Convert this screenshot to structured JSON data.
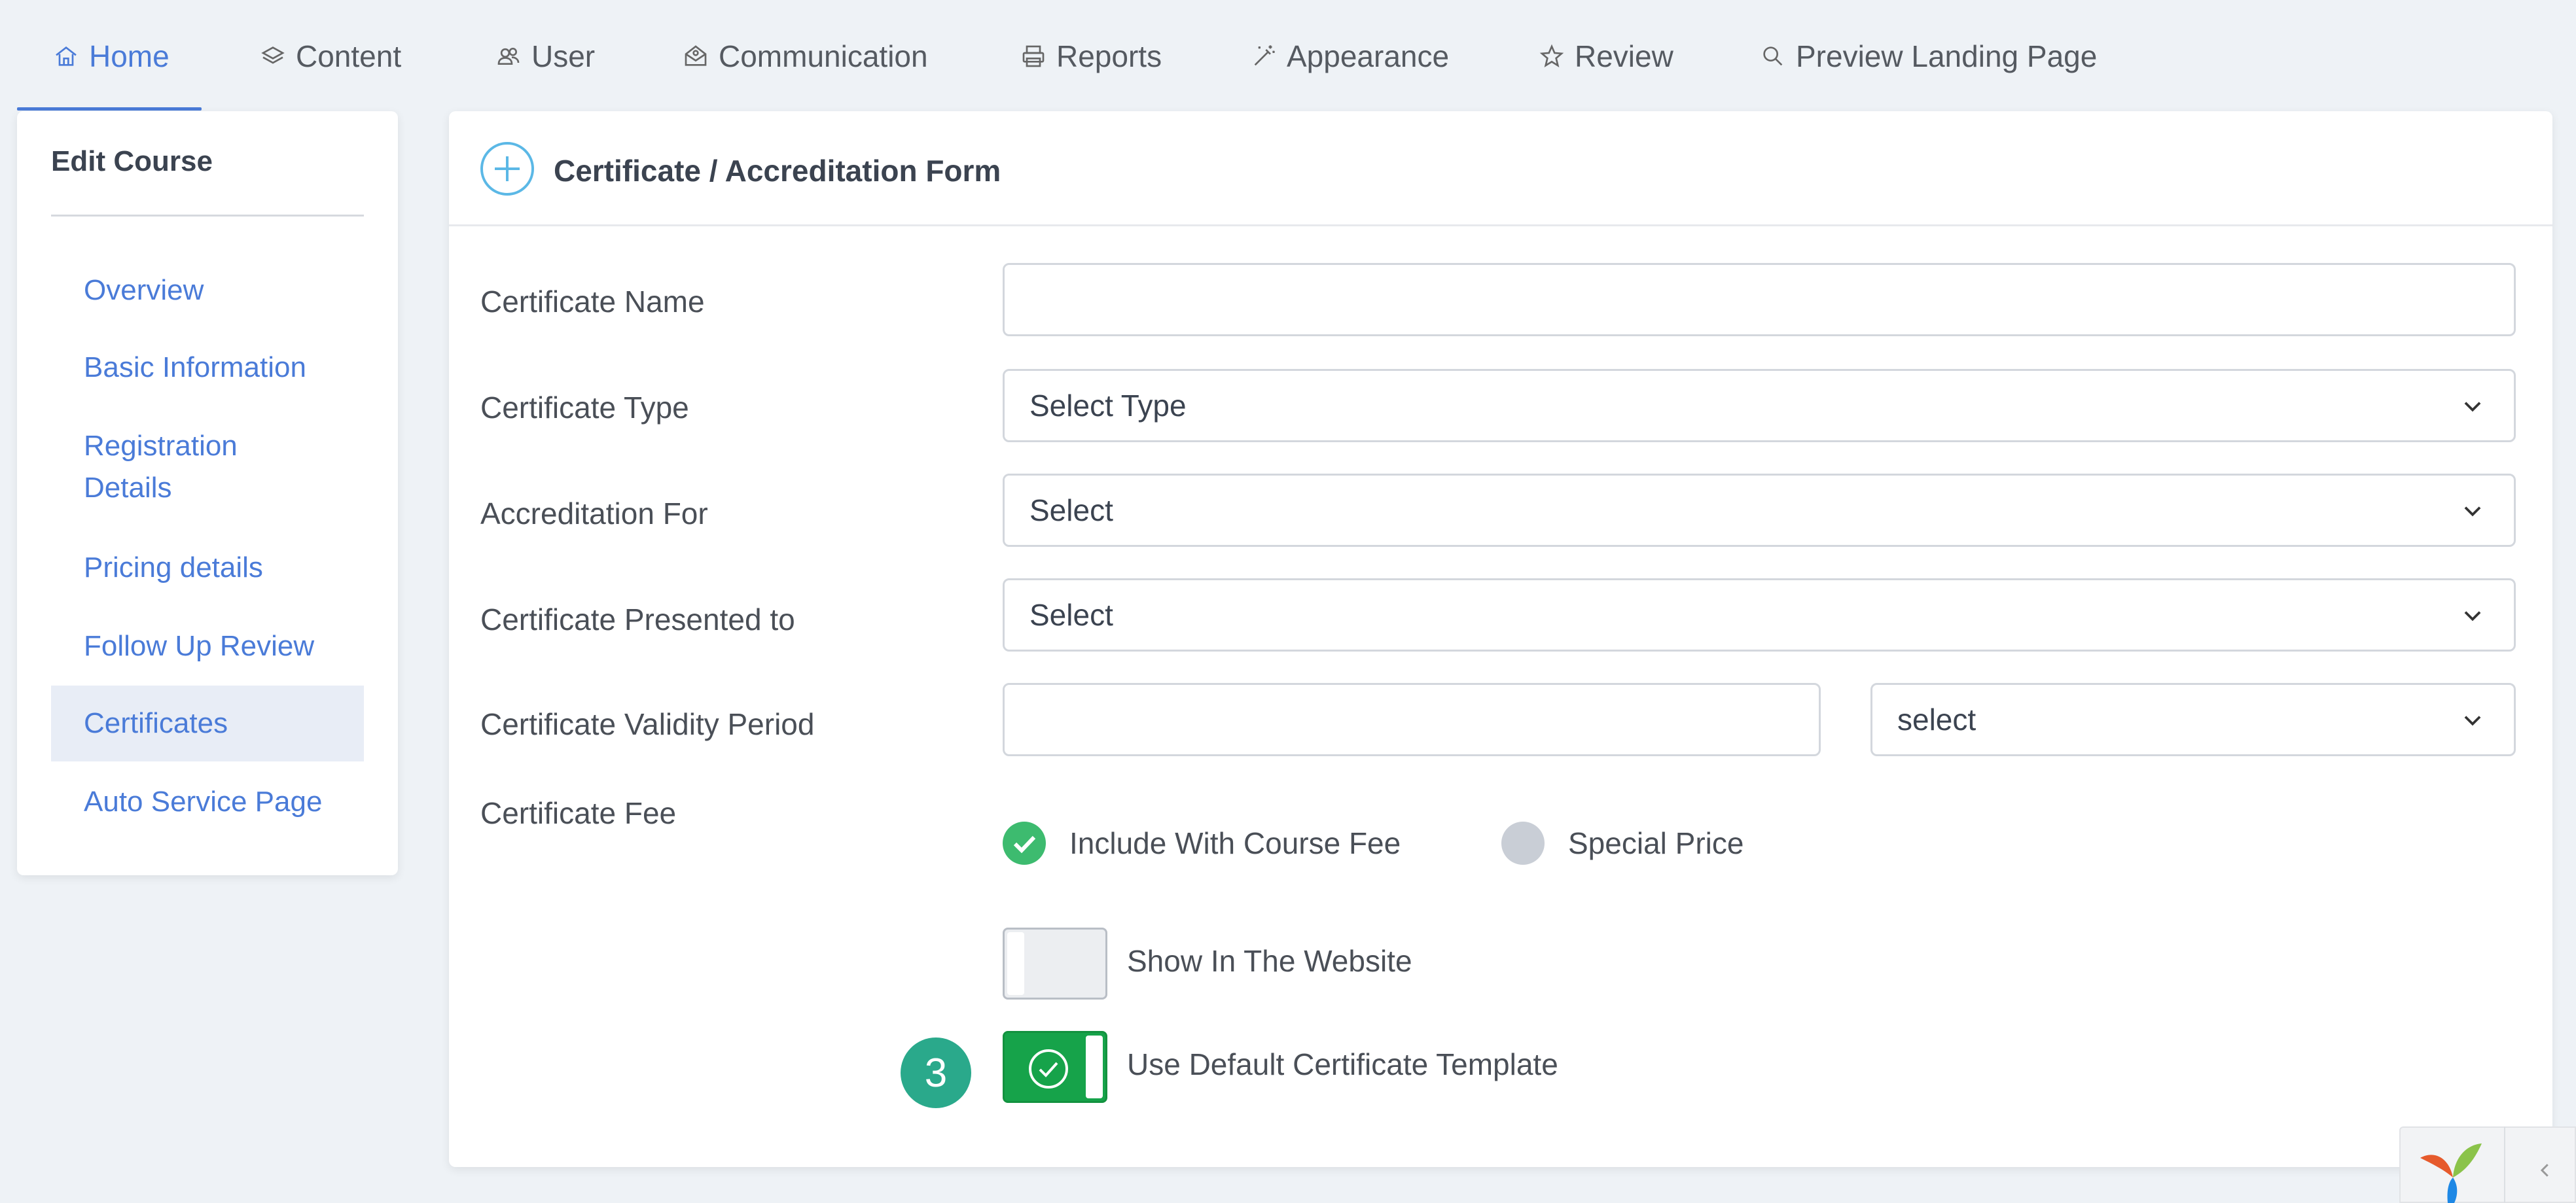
{
  "nav": {
    "tabs": [
      {
        "label": "Home",
        "icon": "home-icon"
      },
      {
        "label": "Content",
        "icon": "layers-icon"
      },
      {
        "label": "User",
        "icon": "users-icon"
      },
      {
        "label": "Communication",
        "icon": "envelope-open-icon"
      },
      {
        "label": "Reports",
        "icon": "printer-icon"
      },
      {
        "label": "Appearance",
        "icon": "magic-wand-icon"
      },
      {
        "label": "Review",
        "icon": "star-icon"
      },
      {
        "label": "Preview Landing Page",
        "icon": "search-icon"
      }
    ],
    "active_tab": "Home",
    "accent_color": "#4a7bd8"
  },
  "sidebar": {
    "title": "Edit Course",
    "items": [
      {
        "label": "Overview"
      },
      {
        "label": "Basic Information"
      },
      {
        "label": "Registration Details",
        "line1": "Registration",
        "line2": "Details"
      },
      {
        "label": "Pricing details"
      },
      {
        "label": "Follow Up Review"
      },
      {
        "label": "Certificates"
      },
      {
        "label": "Auto Service Page"
      }
    ],
    "active_item": "Certificates"
  },
  "form": {
    "title": "Certificate / Accreditation Form",
    "fields": {
      "certificate_name": {
        "label": "Certificate Name",
        "value": ""
      },
      "certificate_type": {
        "label": "Certificate Type",
        "value": "Select Type"
      },
      "accreditation_for": {
        "label": "Accreditation For",
        "value": "Select"
      },
      "presented_to": {
        "label": "Certificate Presented to",
        "value": "Select"
      },
      "validity_period": {
        "label": "Certificate Validity Period",
        "value": "",
        "unit_value": "select"
      },
      "certificate_fee": {
        "label": "Certificate Fee",
        "options": [
          {
            "label": "Include With Course Fee",
            "selected": true
          },
          {
            "label": "Special Price",
            "selected": false
          }
        ]
      }
    },
    "toggles": {
      "show_in_website": {
        "label": "Show In The Website",
        "on": false
      },
      "use_default_template": {
        "label": "Use Default Certificate Template",
        "on": true
      }
    }
  },
  "step_badge": "3",
  "colors": {
    "toggle_on": "#16a34a",
    "radio_on": "#3dbb6f",
    "badge": "#2aa98b",
    "header_icon": "#5bb8e6"
  }
}
